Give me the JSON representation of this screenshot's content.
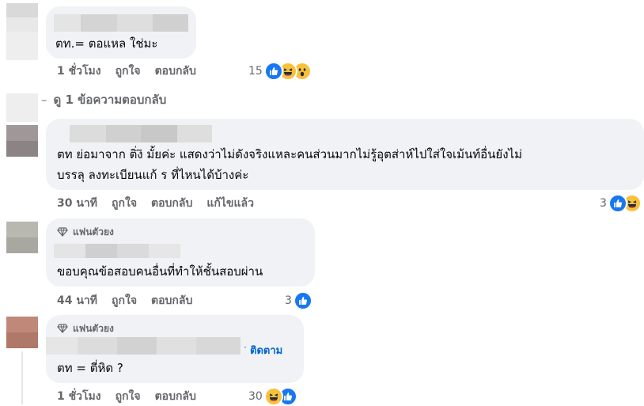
{
  "colors": {
    "like": "#1877f2",
    "emoji": "#f7c23b",
    "bubble": "#f0f2f5",
    "action": "#65676b",
    "link": "#0064d1"
  },
  "comments": [
    {
      "text_lines": [
        "ตท.= ตอแหล ใช่มะ"
      ],
      "time": "1 ชั่วโมง",
      "like_label": "ถูกใจ",
      "reply_label": "ตอบกลับ",
      "reaction_count": "15",
      "reactions": [
        "like-icon",
        "haha-icon",
        "wow-icon"
      ]
    },
    {
      "text_lines": [
        "ตท ย่อมาจาก ติ่ง̃  มั้ยค่ะ แสดงว่าไม่ดังจริงแหละคนส่วนมากไม่รู้อุตส่าห์ไปใส่ใจเม้นท์อื่นยังไม่",
        "บรรลุ ลงทะเบียนแก้ ร ที่ไหนได้บ้างค่ะ"
      ],
      "time": "30 นาที",
      "like_label": "ถูกใจ",
      "reply_label": "ตอบกลับ",
      "edited_label": "แก้ไขแล้ว",
      "reaction_count": "3",
      "reactions": [
        "like-icon",
        "haha-icon"
      ]
    },
    {
      "badge": "แฟนตัวยง",
      "text_lines": [
        "ขอบคุณข้อสอบคนอื่นที่ทำให้ชั้นสอบผ่าน"
      ],
      "time": "44 นาที",
      "like_label": "ถูกใจ",
      "reply_label": "ตอบกลับ",
      "reaction_count": "3",
      "reactions": [
        "like-icon"
      ]
    },
    {
      "badge": "แฟนตัวยง",
      "follow_label": "ติดตาม",
      "text_lines": [
        "ตท = ตี่หิด ?"
      ],
      "time": "1 ชั่วโมง",
      "like_label": "ถูกใจ",
      "reply_label": "ตอบกลับ",
      "reaction_count": "30",
      "reactions": [
        "haha-icon",
        "like-icon"
      ]
    }
  ],
  "view_replies": {
    "dash": "–",
    "label": "ดู 1 ข้อความตอบกลับ"
  }
}
